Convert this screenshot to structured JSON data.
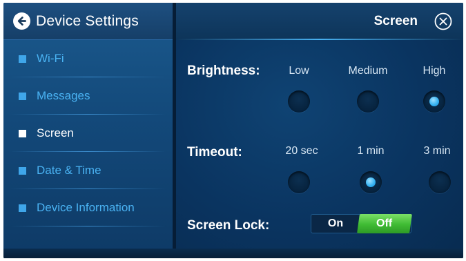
{
  "sidebar": {
    "title": "Device Settings",
    "back_icon": "back-arrow-icon",
    "items": [
      {
        "label": "Wi-Fi",
        "selected": false
      },
      {
        "label": "Messages",
        "selected": false
      },
      {
        "label": "Screen",
        "selected": true
      },
      {
        "label": "Date & Time",
        "selected": false
      },
      {
        "label": "Device Information",
        "selected": false
      }
    ]
  },
  "main": {
    "title": "Screen",
    "close_icon": "close-circle-icon",
    "brightness": {
      "label": "Brightness:",
      "options": [
        "Low",
        "Medium",
        "High"
      ],
      "selected": "High"
    },
    "timeout": {
      "label": "Timeout:",
      "options": [
        "20 sec",
        "1 min",
        "3 min"
      ],
      "selected": "1 min"
    },
    "screen_lock": {
      "label": "Screen Lock:",
      "on_label": "On",
      "off_label": "Off",
      "value": "Off"
    }
  },
  "colors": {
    "accent": "#3fa6ea",
    "toggle_active": "#3fbb33",
    "background": "#0b2f52"
  }
}
